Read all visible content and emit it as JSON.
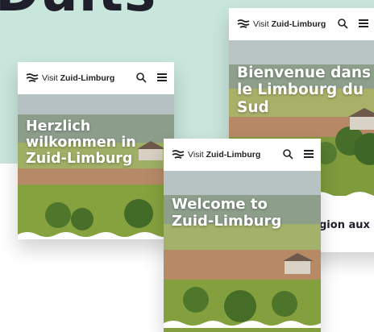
{
  "headline": "Duits",
  "brand": {
    "prefix": "Visit",
    "name": "Zuid-Limburg"
  },
  "icons": {
    "logo": "zuid-limburg-logo-icon",
    "search": "search-icon",
    "menu": "hamburger-menu-icon"
  },
  "cards": {
    "de": {
      "hero_line1": "Herzlich",
      "hero_line2": "wilkommen in",
      "hero_line3": "Zuid-Limburg"
    },
    "fr": {
      "hero_line1": "Bienvenue dans",
      "hero_line2": "le Limbourg du",
      "hero_line3": "Sud",
      "body_snippet": "gion aux"
    },
    "en": {
      "hero_line1": "Welcome to",
      "hero_line2": "Zuid-Limburg"
    }
  },
  "colors": {
    "background_mint": "#c9e6dc",
    "text_dark": "#1f1f2b"
  }
}
